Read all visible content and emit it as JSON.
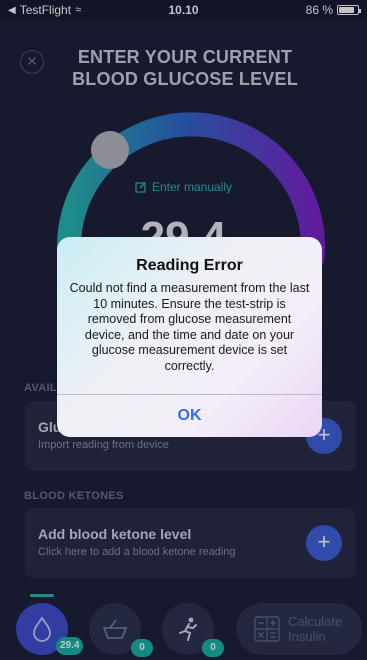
{
  "status_bar": {
    "app_back": "TestFlight",
    "time": "10.10",
    "battery": "86 %",
    "battery_level": 0.86
  },
  "header": {
    "title_line1": "ENTER YOUR CURRENT",
    "title_line2": "BLOOD GLUCOSE LEVEL"
  },
  "gauge": {
    "enter_manually": "Enter manually",
    "value": "29.4"
  },
  "available_section": {
    "label": "AVAILABLE",
    "card_title": "Glucose",
    "card_subtitle": "Import reading from device"
  },
  "ketones_section": {
    "label": "BLOOD KETONES",
    "card_title": "Add blood ketone level",
    "card_subtitle": "Click here to add a blood ketone reading"
  },
  "tabs": {
    "glucose_badge": "29.4",
    "carbs_badge": "0",
    "exercise_badge": "0",
    "calculate_label": "Calculate Insulin"
  },
  "alert": {
    "title": "Reading Error",
    "message": "Could not find a measurement from the last 10 minutes. Ensure the test-strip is removed from glucose measurement device, and the time and date on your glucose measurement device is set correctly.",
    "ok_label": "OK"
  },
  "colors": {
    "background": "#1a1d33",
    "teal": "#23b7ae",
    "purple": "#7a22c9",
    "accent_blue": "#3b5fd9",
    "alert_link": "#2f6fe0"
  }
}
